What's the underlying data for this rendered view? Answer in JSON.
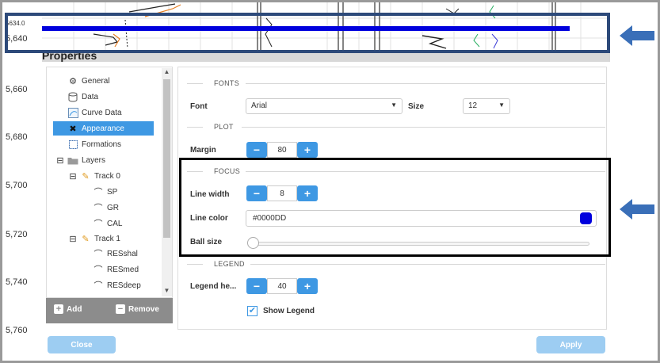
{
  "ruler": {
    "depth_labels": [
      "5634.0",
      "5,640",
      "5,660",
      "5,680",
      "5,700",
      "5,720",
      "5,740",
      "5,760"
    ]
  },
  "properties": {
    "title": "Properties"
  },
  "tree": {
    "items": [
      {
        "label": "General",
        "icon": "gear-icon"
      },
      {
        "label": "Data",
        "icon": "database-icon"
      },
      {
        "label": "Curve Data",
        "icon": "curve-data-icon"
      },
      {
        "label": "Appearance",
        "icon": "tools-icon",
        "selected": true
      },
      {
        "label": "Formations",
        "icon": "formations-icon"
      },
      {
        "label": "Layers",
        "icon": "folder-icon",
        "expander": "⊟"
      },
      {
        "label": "Track 0",
        "icon": "pencil-icon",
        "expander": "⊟"
      },
      {
        "label": "SP",
        "icon": "curve-icon"
      },
      {
        "label": "GR",
        "icon": "curve-icon"
      },
      {
        "label": "CAL",
        "icon": "curve-icon"
      },
      {
        "label": "Track 1",
        "icon": "pencil-icon",
        "expander": "⊟"
      },
      {
        "label": "RESshal",
        "icon": "curve-icon"
      },
      {
        "label": "RESmed",
        "icon": "curve-icon"
      },
      {
        "label": "RESdeep",
        "icon": "curve-icon"
      }
    ],
    "add_label": "Add",
    "remove_label": "Remove"
  },
  "form": {
    "fonts_section": "FONTS",
    "font_label": "Font",
    "font_value": "Arial",
    "size_label": "Size",
    "size_value": "12",
    "plot_section": "PLOT",
    "margin_label": "Margin",
    "margin_value": "80",
    "focus_section": "FOCUS",
    "line_width_label": "Line width",
    "line_width_value": "8",
    "line_color_label": "Line color",
    "line_color_value": "#0000DD",
    "ball_size_label": "Ball size",
    "ball_size_value": 0,
    "legend_section": "LEGEND",
    "legend_height_label": "Legend he...",
    "legend_height_value": "40",
    "show_legend_label": "Show Legend",
    "show_legend_checked": true
  },
  "footer": {
    "close_label": "Close",
    "apply_label": "Apply"
  },
  "colors": {
    "accent": "#3e98e3",
    "focus_line": "#0000DD",
    "highlight_frame": "#2d4a7a",
    "arrow": "#3a6fb8"
  }
}
